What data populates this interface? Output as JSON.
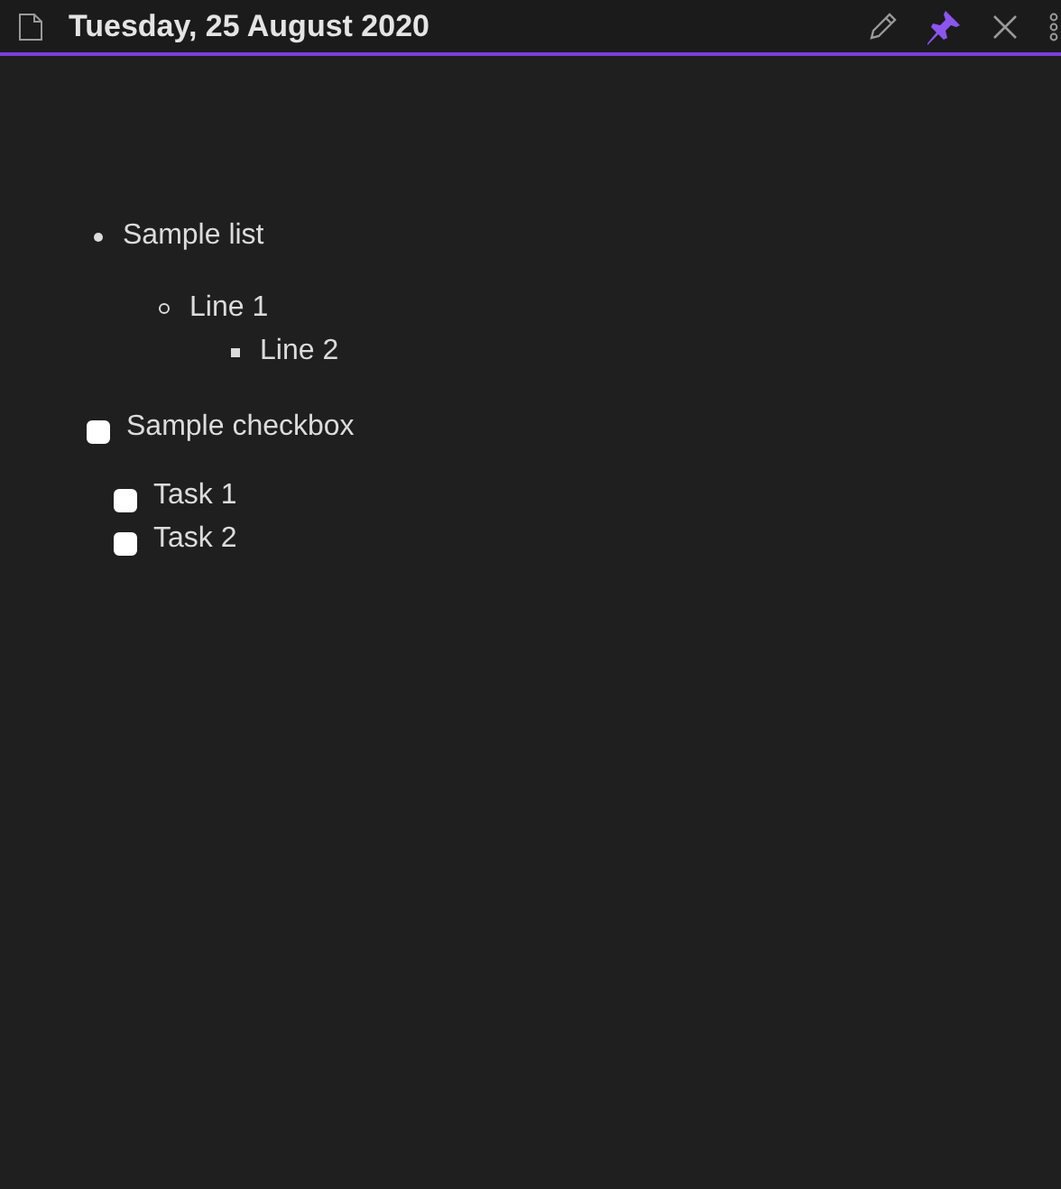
{
  "header": {
    "title": "Tuesday, 25 August 2020",
    "pinned": true
  },
  "list": [
    {
      "text": "Sample list",
      "children": [
        {
          "text": "Line 1",
          "children": [
            {
              "text": "Line 2"
            }
          ]
        }
      ]
    }
  ],
  "checklist": [
    {
      "text": "Sample checkbox",
      "checked": false,
      "children": [
        {
          "text": "Task 1",
          "checked": false
        },
        {
          "text": "Task 2",
          "checked": false
        }
      ]
    }
  ]
}
